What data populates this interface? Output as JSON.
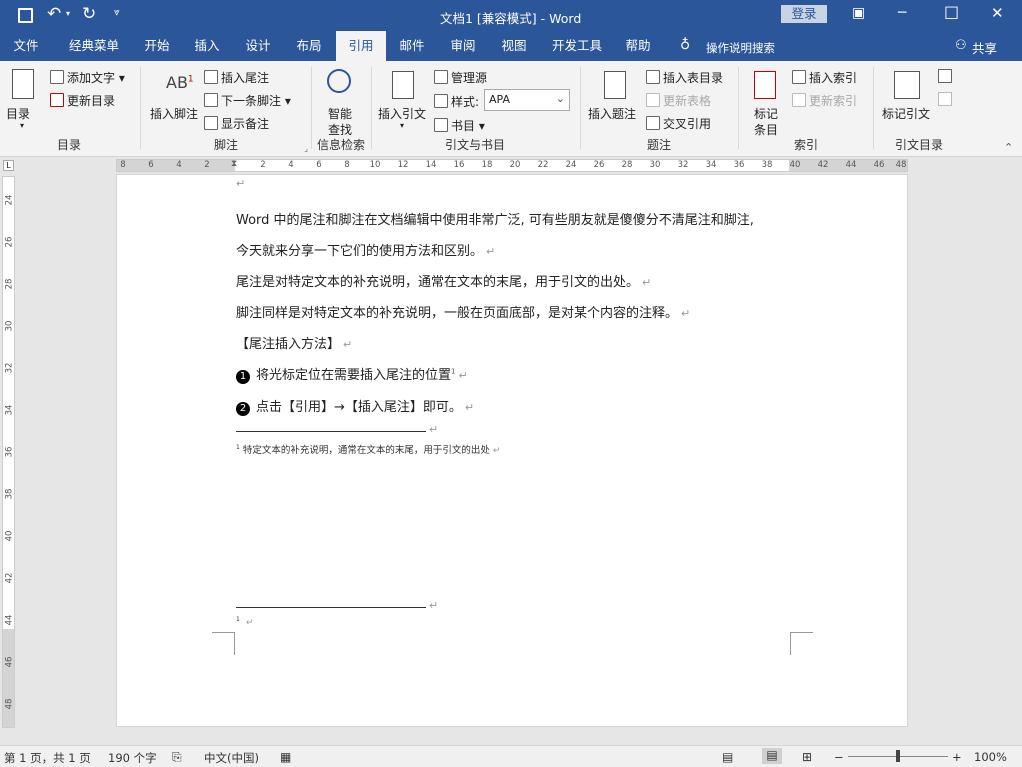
{
  "titlebar": {
    "title": "文档1 [兼容模式] - Word",
    "login": "登录",
    "minimize_icon": "─",
    "restore_icon": "□",
    "close_icon": "✕",
    "ribbon_display_icon": "▣"
  },
  "tabs": [
    "文件",
    "经典菜单",
    "开始",
    "插入",
    "设计",
    "布局",
    "引用",
    "邮件",
    "审阅",
    "视图",
    "开发工具",
    "帮助"
  ],
  "active_tab": "引用",
  "search_label": "操作说明搜索",
  "share_label": "共享",
  "ribbon": {
    "toc": {
      "big": "目录",
      "add_text": "添加文字",
      "update": "更新目录",
      "label": "目录"
    },
    "footnote": {
      "insert_footnote": "插入脚注",
      "ab_label": "AB",
      "ab_sup": "1",
      "insert_endnote": "插入尾注",
      "next_footnote": "下一条脚注",
      "show_notes": "显示备注",
      "label": "脚注"
    },
    "research": {
      "smart_1": "智能",
      "smart_2": "查找",
      "label": "信息检索"
    },
    "citations": {
      "insert_citation": "插入引文",
      "manage_sources": "管理源",
      "style": "样式:",
      "style_value": "APA",
      "bibliography": "书目",
      "label": "引文与书目"
    },
    "captions": {
      "insert_caption": "插入题注",
      "insert_tof": "插入表目录",
      "update_table": "更新表格",
      "cross_ref": "交叉引用",
      "label": "题注"
    },
    "index": {
      "mark_entry_1": "标记",
      "mark_entry_2": "条目",
      "insert_index": "插入索引",
      "update_index": "更新索引",
      "label": "索引"
    },
    "toa": {
      "mark_citation": "标记引文",
      "label": "引文目录"
    }
  },
  "ruler": {
    "h_ticks": [
      "8",
      "6",
      "4",
      "2",
      "",
      "2",
      "4",
      "6",
      "8",
      "10",
      "12",
      "14",
      "16",
      "18",
      "20",
      "22",
      "24",
      "26",
      "28",
      "30",
      "32",
      "34",
      "36",
      "38",
      "40",
      "42",
      "44",
      "46",
      "48"
    ],
    "v_ticks": [
      "24",
      "26",
      "28",
      "30",
      "32",
      "34",
      "36",
      "38",
      "40",
      "42",
      "44",
      "46",
      "48"
    ]
  },
  "document": {
    "p1": "Word 中的尾注和脚注在文档编辑中使用非常广泛, 可有些朋友就是傻傻分不清尾注和脚注,",
    "p2": "今天就来分享一下它们的使用方法和区别。",
    "p3": "尾注是对特定文本的补充说明，通常在文本的末尾，用于引文的出处。",
    "p4": "脚注同样是对特定文本的补充说明，一般在页面底部，是对某个内容的注释。",
    "p5": "【尾注插入方法】",
    "step1_num": "1",
    "step1": "将光标定位在需要插入尾注的位置",
    "step2_num": "2",
    "step2": "点击【引用】→【插入尾注】即可。",
    "endnote_text": "特定文本的补充说明，通常在文本的末尾，用于引文的出处",
    "note_marker": "1",
    "para_mark": "↵"
  },
  "statusbar": {
    "page": "第 1 页，共 1 页",
    "words": "190 个字",
    "language": "中文(中国)",
    "zoom": "100%",
    "zoom_minus": "−",
    "zoom_plus": "+"
  }
}
